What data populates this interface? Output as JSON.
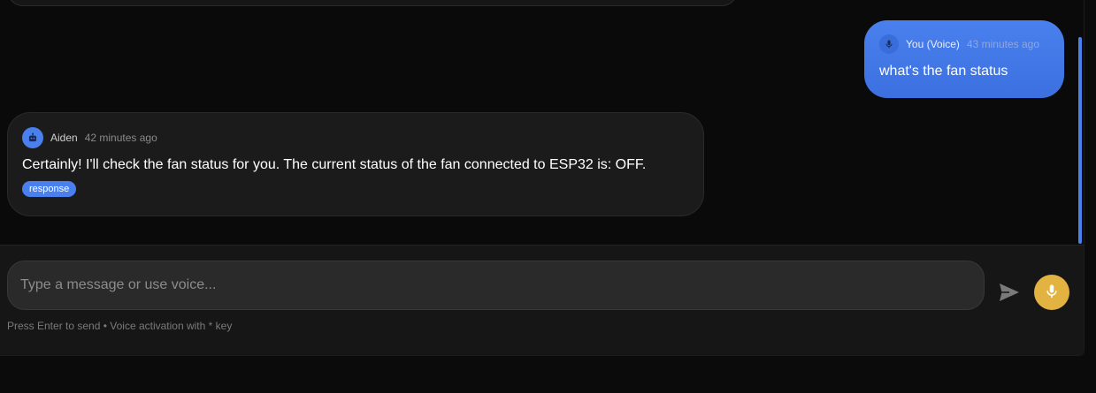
{
  "conversation": {
    "user_message": {
      "sender": "You (Voice)",
      "time": "43 minutes ago",
      "text": "what's the fan status",
      "icon": "microphone-icon"
    },
    "assistant_message": {
      "sender": "Aiden",
      "time": "42 minutes ago",
      "text": "Certainly! I'll check the fan status for you. The current status of the fan connected to ESP32 is: OFF.",
      "tag": "response",
      "icon": "robot-icon"
    }
  },
  "composer": {
    "placeholder": "Type a message or use voice...",
    "value": "",
    "hint": "Press Enter to send • Voice activation with * key",
    "send_icon": "send-icon",
    "voice_icon": "microphone-icon"
  },
  "colors": {
    "accent": "#4a80ee",
    "voice_button": "#e3b341",
    "background": "#0a0a0a"
  }
}
